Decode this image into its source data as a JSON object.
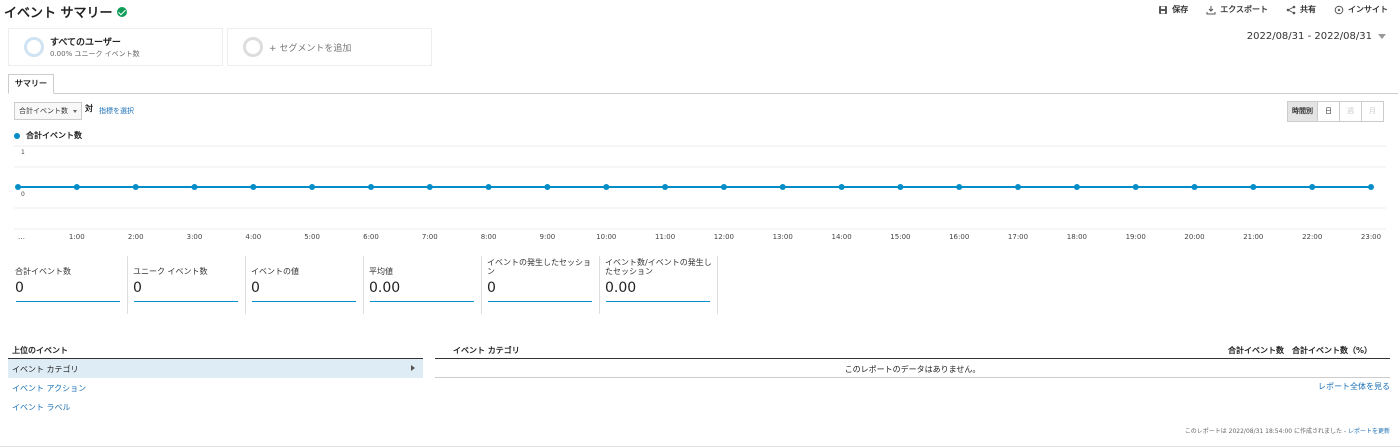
{
  "header": {
    "title": "イベント サマリー",
    "tools": [
      {
        "name": "save",
        "label": "保存"
      },
      {
        "name": "export",
        "label": "エクスポート"
      },
      {
        "name": "share",
        "label": "共有"
      },
      {
        "name": "insight",
        "label": "インサイト"
      }
    ]
  },
  "segments": {
    "all_users": {
      "name": "すべてのユーザー",
      "sub": "0.00% ユニーク イベント数"
    },
    "add_label": "+ セグメントを追加"
  },
  "date_range": "2022/08/31 - 2022/08/31",
  "tabs": [
    {
      "label": "サマリー"
    }
  ],
  "controls": {
    "metric": "合計イベント数",
    "vs": "対",
    "choose_metric": "指標を選択",
    "granularity": [
      "時間別",
      "日",
      "週",
      "月"
    ]
  },
  "chart_data": {
    "type": "line",
    "series": [
      {
        "name": "合計イベント数",
        "values": [
          0,
          0,
          0,
          0,
          0,
          0,
          0,
          0,
          0,
          0,
          0,
          0,
          0,
          0,
          0,
          0,
          0,
          0,
          0,
          0,
          0,
          0,
          0,
          0
        ]
      }
    ],
    "x": [
      "…",
      "1:00",
      "2:00",
      "3:00",
      "4:00",
      "5:00",
      "6:00",
      "7:00",
      "8:00",
      "9:00",
      "10:00",
      "11:00",
      "12:00",
      "13:00",
      "14:00",
      "15:00",
      "16:00",
      "17:00",
      "18:00",
      "19:00",
      "20:00",
      "21:00",
      "22:00",
      "23:00"
    ],
    "ylim": [
      0,
      1
    ],
    "yticks": [
      "0",
      "1"
    ],
    "grid": true,
    "legend": "top-left",
    "color": "#058dc7"
  },
  "scorecards": [
    {
      "label": "合計イベント数",
      "value": "0"
    },
    {
      "label": "ユニーク イベント数",
      "value": "0"
    },
    {
      "label": "イベントの値",
      "value": "0"
    },
    {
      "label": "平均値",
      "value": "0.00"
    },
    {
      "label": "イベントの発生したセッション",
      "value": "0"
    },
    {
      "label": "イベント数/イベントの発生したセッション",
      "value": "0.00"
    }
  ],
  "top_events": {
    "heading": "上位のイベント",
    "items": [
      "イベント カテゴリ",
      "イベント アクション",
      "イベント ラベル"
    ]
  },
  "table": {
    "columns": [
      "イベント カテゴリ",
      "合計イベント数",
      "合計イベント数（%）"
    ],
    "empty": "このレポートのデータはありません。",
    "full_report": "レポート全体を見る"
  },
  "footer": {
    "text": "このレポートは 2022/08/31 18:54:00 に作成されました - ",
    "refresh": "レポートを更新"
  }
}
